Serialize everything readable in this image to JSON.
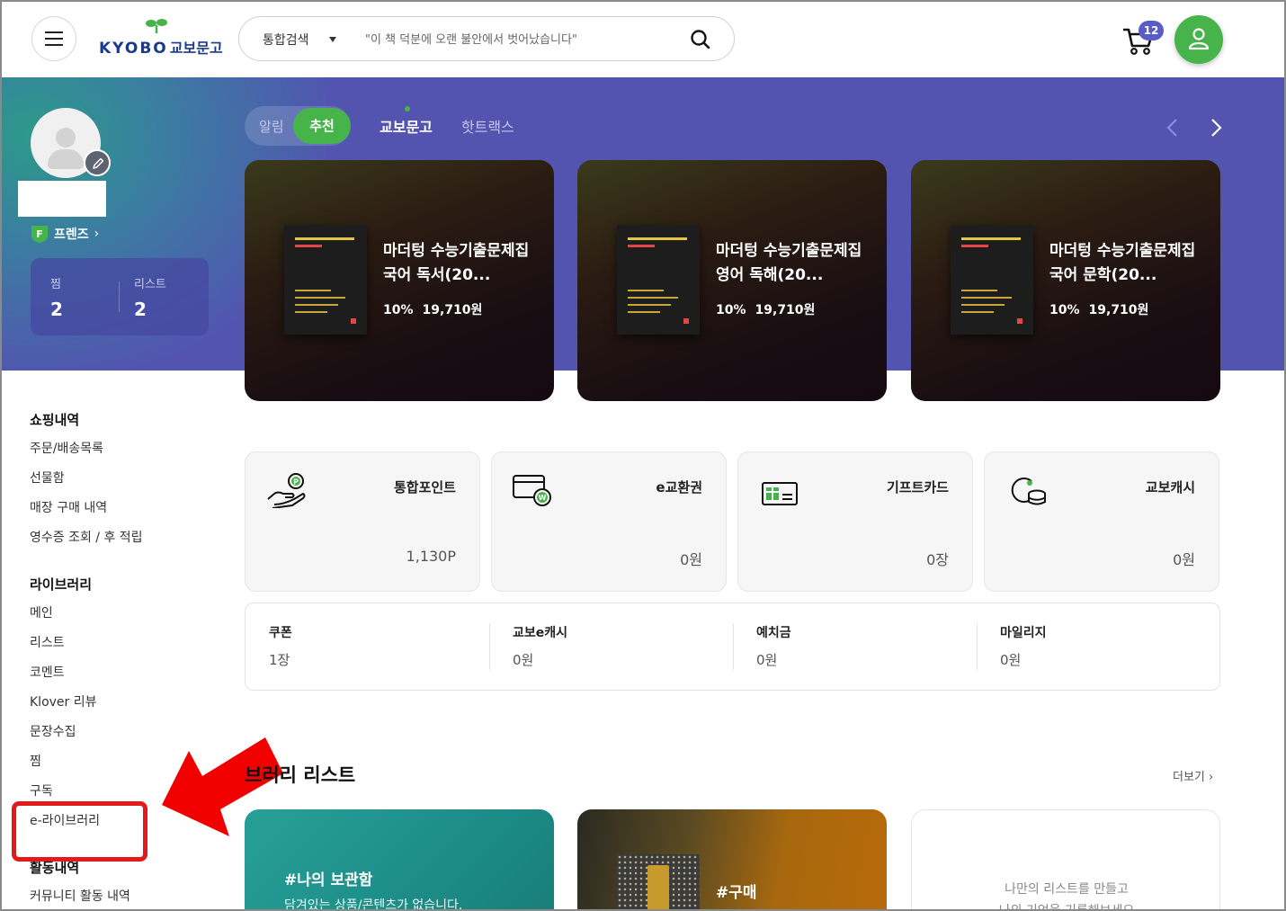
{
  "header": {
    "logo_en": "KYOBO",
    "logo_ko": "교보문고",
    "search_category": "통합검색",
    "search_placeholder": "\"이 책 덕분에 오랜 불안에서 벗어났습니다\"",
    "cart_count": "12"
  },
  "profile": {
    "grade_badge": "F",
    "grade_label": "프렌즈",
    "grade_arrow": "›",
    "stats": [
      {
        "label": "찜",
        "value": "2"
      },
      {
        "label": "리스트",
        "value": "2"
      }
    ]
  },
  "recommend": {
    "tabs": [
      "알림",
      "추천",
      "교보문고",
      "핫트랙스"
    ],
    "active_tab": "추천",
    "cards": [
      {
        "cover_text": "2026 마더텅 수능기출문제집 국어 독서",
        "title": "마더텅 수능기출문제집 국어 독서(20...",
        "discount": "10%",
        "price": "19,710원"
      },
      {
        "cover_text": "2026 마더텅 수능기출문제집 영어 독해",
        "title": "마더텅 수능기출문제집 영어 독해(20...",
        "discount": "10%",
        "price": "19,710원"
      },
      {
        "cover_text": "2026 마더텅 수능기출문제집 국어 문학",
        "title": "마더텅 수능기출문제집 국어 문학(20...",
        "discount": "10%",
        "price": "19,710원"
      }
    ]
  },
  "sidebar": {
    "sections": [
      {
        "title": "쇼핑내역",
        "items": [
          "주문/배송목록",
          "선물함",
          "매장 구매 내역",
          "영수증 조회 / 후 적립"
        ]
      },
      {
        "title": "라이브러리",
        "items": [
          "메인",
          "리스트",
          "코멘트",
          "Klover 리뷰",
          "문장수집",
          "찜",
          "구독",
          "e-라이브러리"
        ]
      },
      {
        "title": "활동내역",
        "items": [
          "커뮤니티 활동 내역"
        ]
      }
    ],
    "highlighted_item": "e-라이브러리"
  },
  "assets": [
    {
      "title": "통합포인트",
      "value": "1,130P",
      "icon": "point-hand-icon"
    },
    {
      "title": "e교환권",
      "value": "0원",
      "icon": "voucher-icon"
    },
    {
      "title": "기프트카드",
      "value": "0장",
      "icon": "gift-card-icon"
    },
    {
      "title": "교보캐시",
      "value": "0원",
      "icon": "coins-icon"
    }
  ],
  "balances": [
    {
      "title": "쿠폰",
      "value": "1장"
    },
    {
      "title": "교보e캐시",
      "value": "0원"
    },
    {
      "title": "예치금",
      "value": "0원"
    },
    {
      "title": "마일리지",
      "value": "0원"
    }
  ],
  "library": {
    "heading": "브러리 리스트",
    "more": "더보기",
    "cards": [
      {
        "tag": "#나의 보관함",
        "desc": "담겨있는 상품/콘텐츠가 없습니다."
      },
      {
        "tag": "#구매"
      },
      {
        "line1": "나만의 리스트를 만들고",
        "line2": "나의 기억을 기록해보세요"
      }
    ]
  },
  "colors": {
    "hero": "#5254b0",
    "accent_green": "#46b34b",
    "badge_purple": "#5a5dc7",
    "highlight_red": "#e41a1a"
  }
}
